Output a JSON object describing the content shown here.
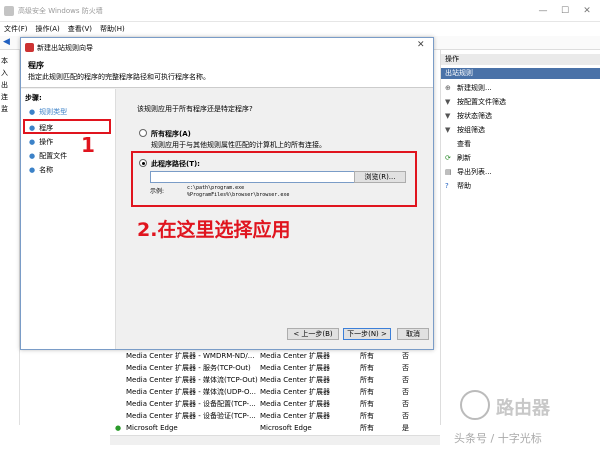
{
  "window": {
    "title": "高级安全 Windows 防火墙",
    "minimize": "—",
    "maximize": "☐",
    "close": "✕"
  },
  "menu": [
    "文件(F)",
    "操作(A)",
    "查看(V)",
    "帮助(H)"
  ],
  "left_tree": [
    "本",
    "入",
    "出",
    "连",
    "监"
  ],
  "actions_panel": {
    "header": "操作",
    "section": "出站规则",
    "items": [
      {
        "icon": "new-rule-icon",
        "glyph": "⊕",
        "label": "新建规则..."
      },
      {
        "icon": "filter-icon",
        "glyph": "▼",
        "label": "按配置文件筛选"
      },
      {
        "icon": "filter-icon",
        "glyph": "▼",
        "label": "按状态筛选"
      },
      {
        "icon": "filter-icon",
        "glyph": "▼",
        "label": "按组筛选"
      },
      {
        "icon": "view-icon",
        "glyph": "",
        "label": "查看"
      },
      {
        "icon": "refresh-icon",
        "glyph": "⟳",
        "label": "刷新"
      },
      {
        "icon": "export-icon",
        "glyph": "▤",
        "label": "导出列表..."
      },
      {
        "icon": "help-icon",
        "glyph": "?",
        "label": "帮助"
      }
    ]
  },
  "rules_list": [
    {
      "name": "Media Center 扩展器 - WMDRM-ND/...",
      "group": "Media Center 扩展器",
      "profile": "所有",
      "enabled": "否"
    },
    {
      "name": "Media Center 扩展器 - 服务(TCP-Out)",
      "group": "Media Center 扩展器",
      "profile": "所有",
      "enabled": "否"
    },
    {
      "name": "Media Center 扩展器 - 媒体流(TCP-Out)",
      "group": "Media Center 扩展器",
      "profile": "所有",
      "enabled": "否"
    },
    {
      "name": "Media Center 扩展器 - 媒体流(UDP-O...",
      "group": "Media Center 扩展器",
      "profile": "所有",
      "enabled": "否"
    },
    {
      "name": "Media Center 扩展器 - 设备配置(TCP-...",
      "group": "Media Center 扩展器",
      "profile": "所有",
      "enabled": "否"
    },
    {
      "name": "Media Center 扩展器 - 设备验证(TCP-...",
      "group": "Media Center 扩展器",
      "profile": "所有",
      "enabled": "否"
    },
    {
      "name": "Microsoft Edge",
      "group": "Microsoft Edge",
      "profile": "所有",
      "enabled": "是"
    }
  ],
  "dialog": {
    "title": "新建出站规则向导",
    "heading": "程序",
    "description": "指定此规则匹配的程序的完整程序路径和可执行程序名称。",
    "steps_header": "步骤:",
    "steps": [
      "规则类型",
      "程序",
      "操作",
      "配置文件",
      "名称"
    ],
    "question": "该规则应用于所有程序还是特定程序?",
    "option_all_label": "所有程序(A)",
    "option_all_desc": "规则应用于与其他规则属性匹配的计算机上的所有连接。",
    "option_path_label": "此程序路径(T):",
    "path_value": "",
    "browse_label": "浏览(R)...",
    "example_label": "示例:",
    "example_line1": "c:\\path\\program.exe",
    "example_line2": "%ProgramFiles%\\browser\\browser.exe",
    "back_label": "< 上一步(B)",
    "next_label": "下一步(N) >",
    "cancel_label": "取消"
  },
  "annotations": {
    "step_number": "1",
    "instruction": "2.在这里选择应用",
    "color": "#e0141e"
  },
  "watermark": {
    "brand": "路由器",
    "source": "头条号 / 十字光标"
  }
}
